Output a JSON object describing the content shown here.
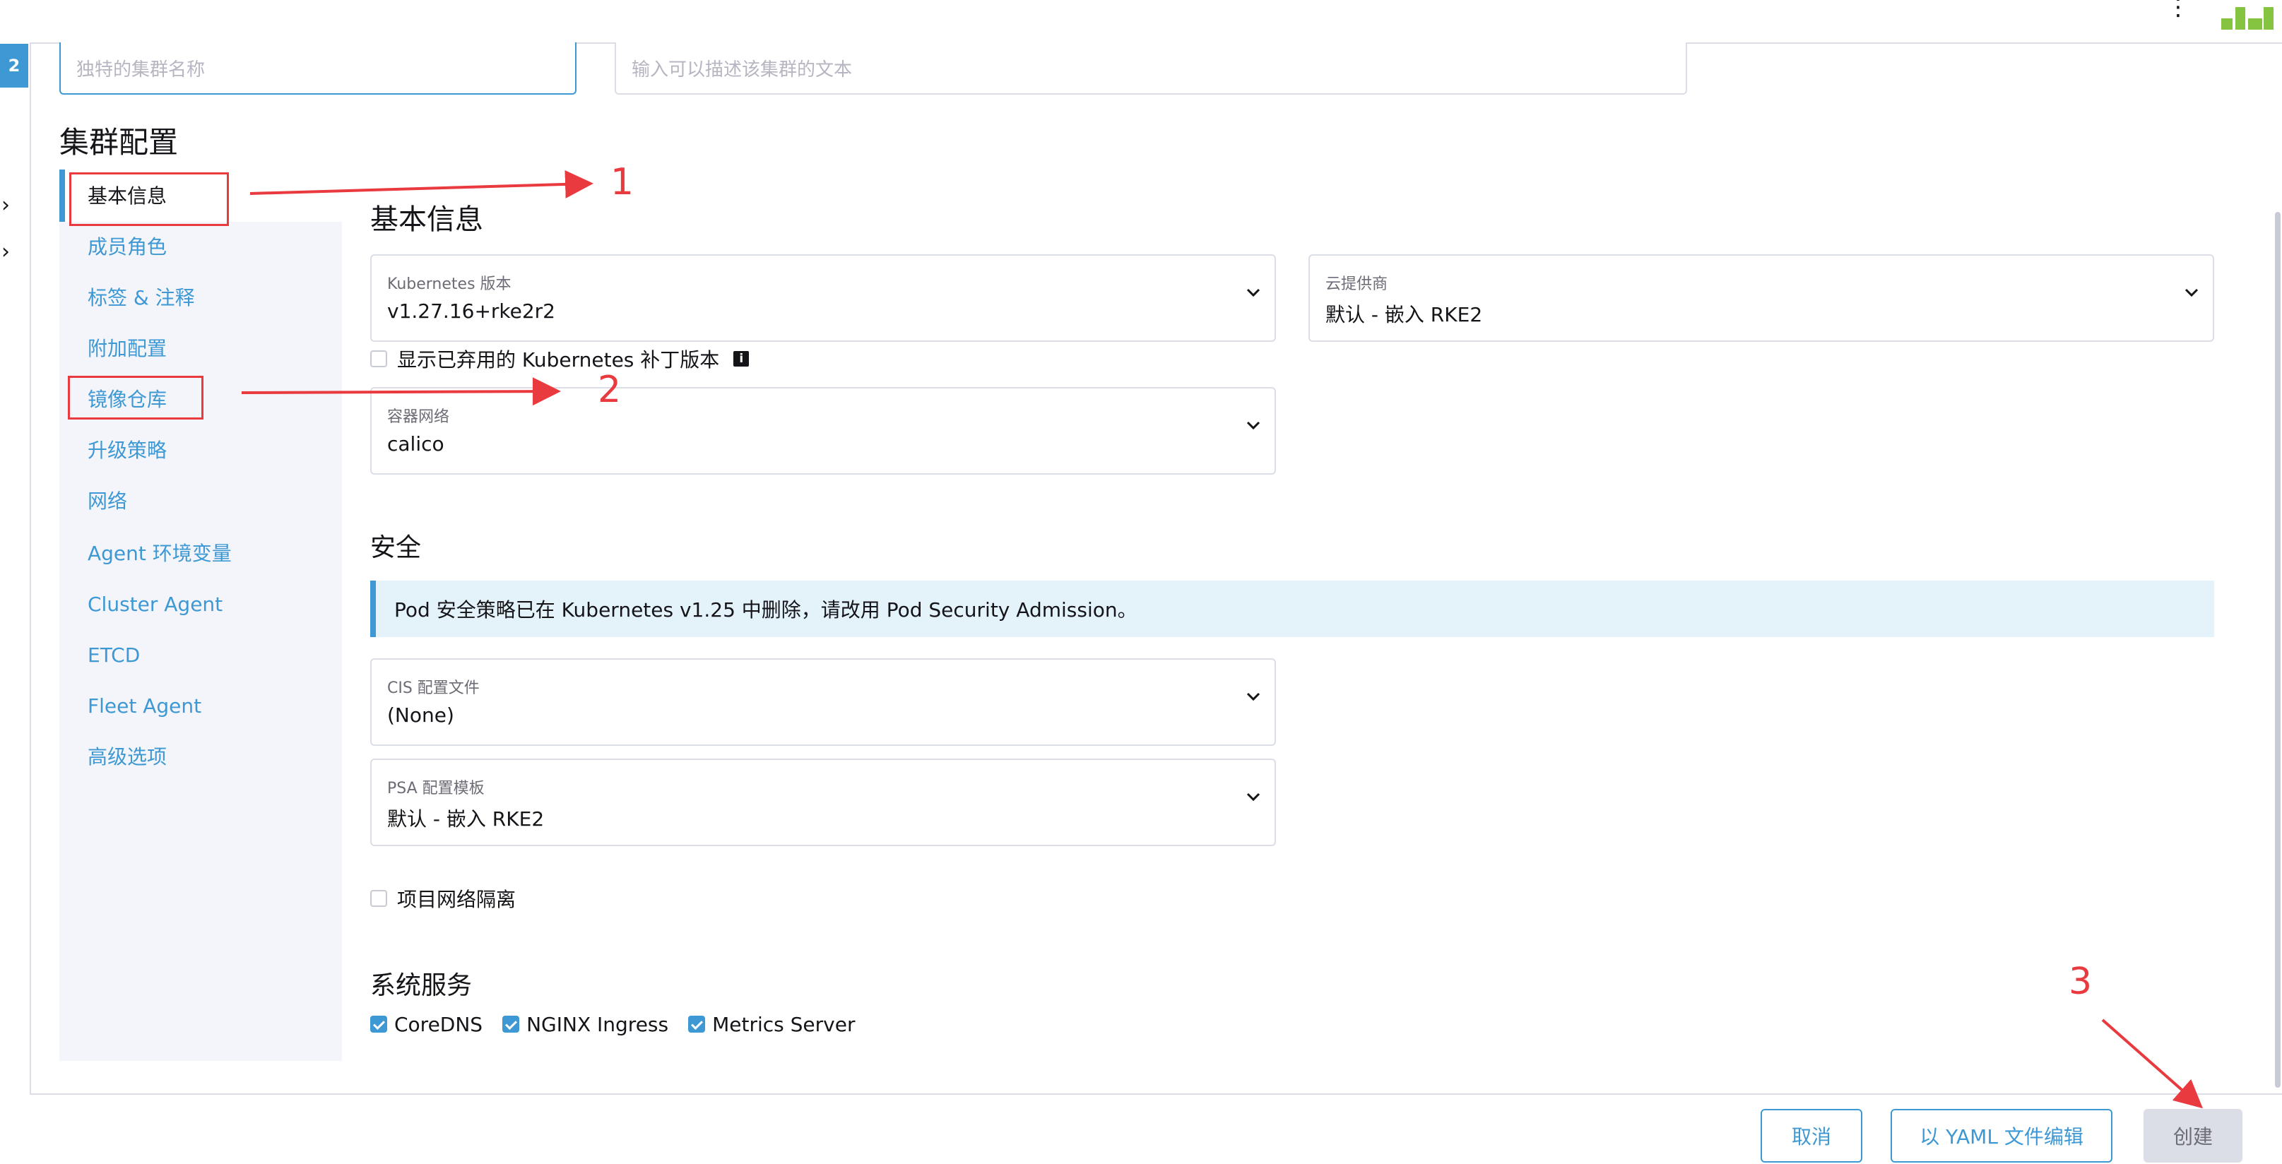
{
  "header": {
    "more_icon": "kebab-vertical-icon",
    "logo": "rancher-logo"
  },
  "rail": {
    "badge_text": "2",
    "chevrons": [
      "›",
      "›"
    ]
  },
  "top_inputs": {
    "name_placeholder": "独特的集群名称",
    "description_placeholder": "输入可以描述该集群的文本"
  },
  "cluster_config": {
    "title": "集群配置",
    "nav": [
      {
        "label": "基本信息",
        "active": true
      },
      {
        "label": "成员角色"
      },
      {
        "label": "标签 & 注释"
      },
      {
        "label": "附加配置"
      },
      {
        "label": "镜像仓库"
      },
      {
        "label": "升级策略"
      },
      {
        "label": "网络"
      },
      {
        "label": "Agent 环境变量"
      },
      {
        "label": "Cluster Agent"
      },
      {
        "label": "ETCD"
      },
      {
        "label": "Fleet Agent"
      },
      {
        "label": "高级选项"
      }
    ]
  },
  "basic": {
    "title": "基本信息",
    "k8s_version": {
      "label": "Kubernetes 版本",
      "value": "v1.27.16+rke2r2"
    },
    "cloud_provider": {
      "label": "云提供商",
      "value": "默认 - 嵌入 RKE2"
    },
    "show_deprecated": {
      "label": "显示已弃用的 Kubernetes 补丁版本",
      "checked": false,
      "info_icon": "i"
    },
    "cni": {
      "label": "容器网络",
      "value": "calico"
    }
  },
  "security": {
    "title": "安全",
    "banner": "Pod 安全策略已在 Kubernetes v1.25 中删除，请改用 Pod Security Admission。",
    "cis": {
      "label": "CIS 配置文件",
      "value": "(None)"
    },
    "psa": {
      "label": "PSA 配置模板",
      "value": "默认 - 嵌入 RKE2"
    },
    "project_isolation": {
      "label": "项目网络隔离",
      "checked": false
    }
  },
  "system_services": {
    "title": "系统服务",
    "items": [
      {
        "label": "CoreDNS",
        "checked": true
      },
      {
        "label": "NGINX Ingress",
        "checked": true
      },
      {
        "label": "Metrics Server",
        "checked": true
      }
    ]
  },
  "footer": {
    "cancel": "取消",
    "edit_yaml": "以 YAML 文件编辑",
    "create": "创建"
  },
  "annotations": {
    "n1": "1",
    "n2": "2",
    "n3": "3",
    "color": "#e93a3f"
  },
  "colors": {
    "accent": "#3d98d3",
    "nav_bg": "#f4f5fa",
    "banner_bg": "#e4f3fa"
  }
}
